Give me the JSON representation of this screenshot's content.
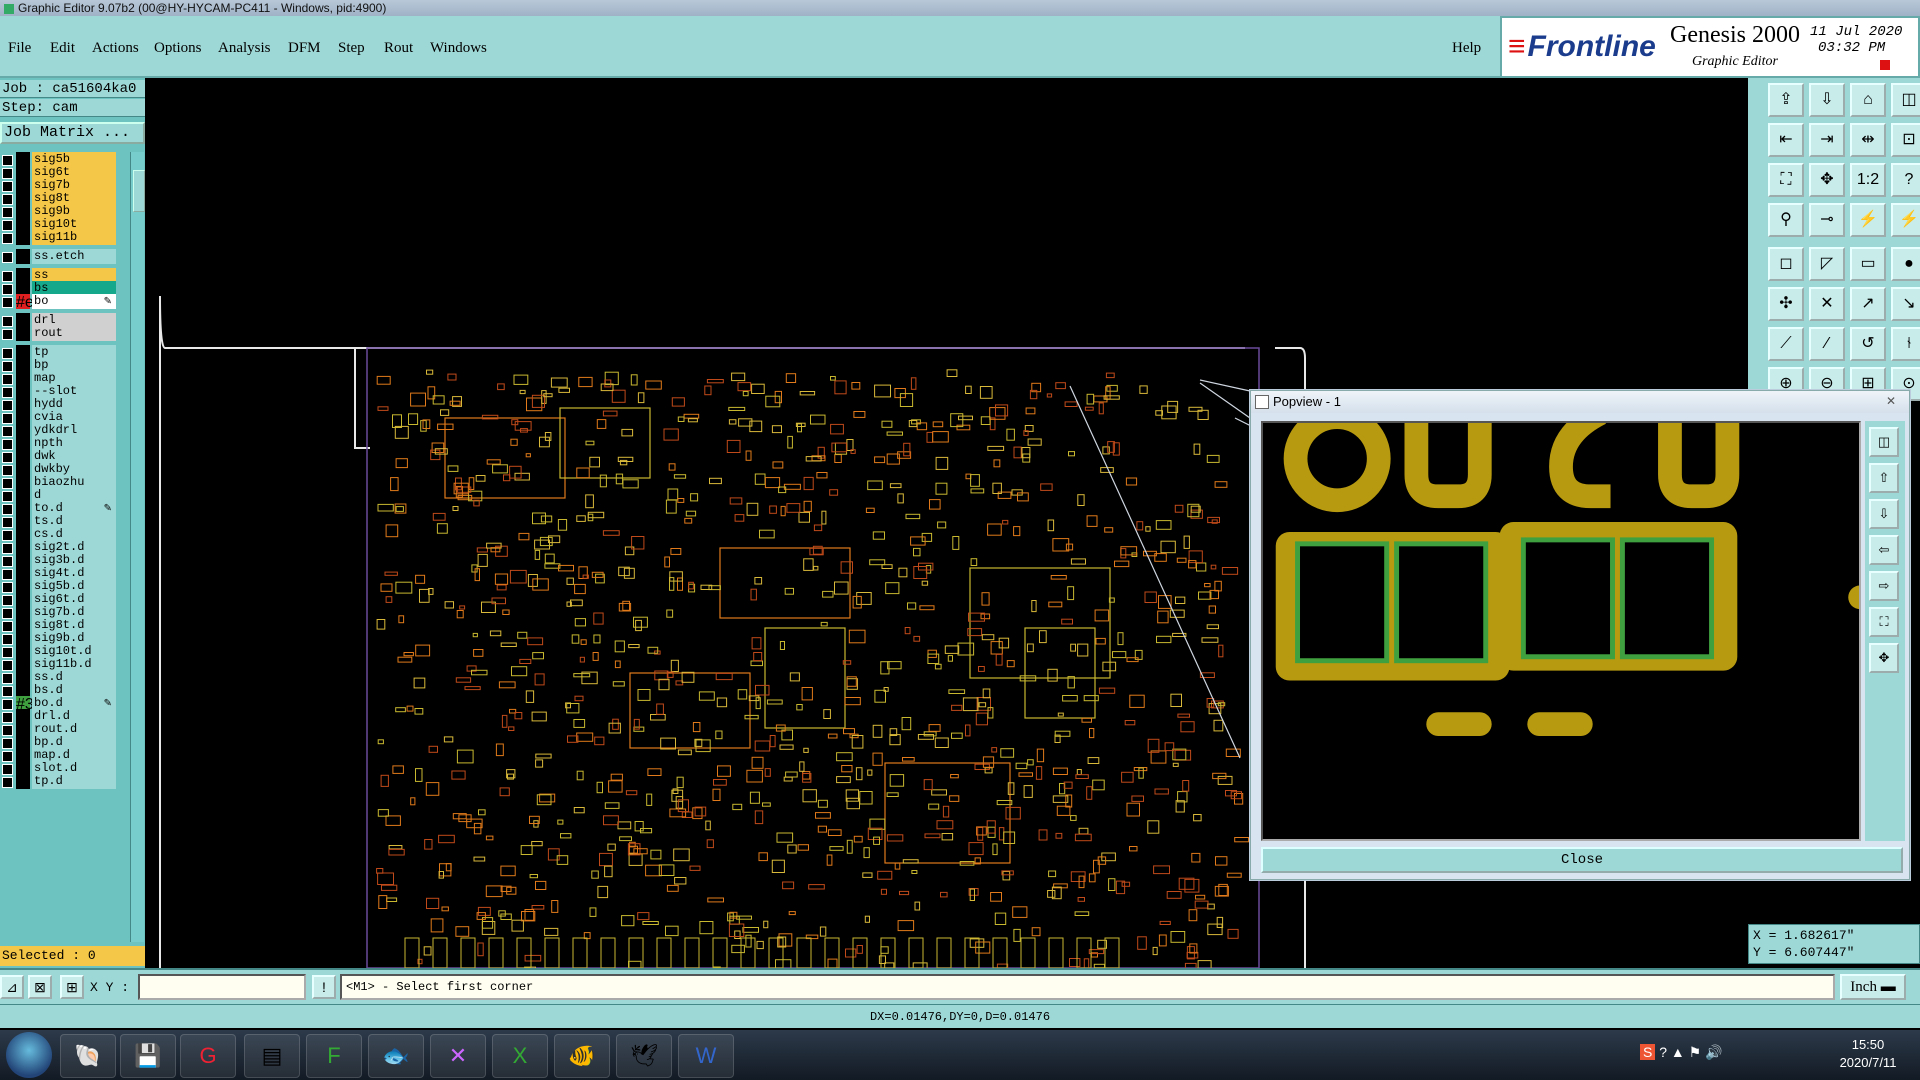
{
  "window": {
    "title": "Graphic Editor 9.07b2 (00@HY-HYCAM-PC411 - Windows, pid:4900)"
  },
  "menu": {
    "items": [
      "File",
      "Edit",
      "Actions",
      "Options",
      "Analysis",
      "DFM",
      "Step",
      "Rout",
      "Windows"
    ],
    "help": "Help"
  },
  "brand": {
    "logo": "Frontline",
    "product": "Genesis 2000",
    "subtitle": "Graphic Editor",
    "date": "11 Jul 2020",
    "time": "03:32 PM"
  },
  "panel": {
    "job": "Job : ca51604ka0",
    "step": "Step: cam",
    "job_matrix": "Job Matrix ...",
    "selected": "Selected : 0"
  },
  "layers": [
    {
      "name": "sig5b",
      "color": "#f5c748",
      "mark": ""
    },
    {
      "name": "sig6t",
      "color": "#f5c748",
      "mark": ""
    },
    {
      "name": "sig7b",
      "color": "#f5c748",
      "mark": ""
    },
    {
      "name": "sig8t",
      "color": "#f5c748",
      "mark": ""
    },
    {
      "name": "sig9b",
      "color": "#f5c748",
      "mark": ""
    },
    {
      "name": "sig10t",
      "color": "#f5c748",
      "mark": ""
    },
    {
      "name": "sig11b",
      "color": "#f5c748",
      "mark": ""
    },
    {
      "name": "ss.etch",
      "color": "#9ed8d6",
      "mark": ""
    },
    {
      "name": "ss",
      "color": "#f5c748",
      "mark": ""
    },
    {
      "name": "bs",
      "color": "#16a88a",
      "mark": ""
    },
    {
      "name": "bo",
      "color": "#ffffff",
      "mark": "✎",
      "swatch": "#e02020"
    },
    {
      "name": "drl",
      "color": "#d0d0d0",
      "mark": ""
    },
    {
      "name": "rout",
      "color": "#d0d0d0",
      "mark": ""
    },
    {
      "name": "tp",
      "color": "#9ed8d6",
      "mark": ""
    },
    {
      "name": "bp",
      "color": "#9ed8d6",
      "mark": ""
    },
    {
      "name": "map",
      "color": "#9ed8d6",
      "mark": ""
    },
    {
      "name": "--slot",
      "color": "#9ed8d6",
      "mark": ""
    },
    {
      "name": "hydd",
      "color": "#9ed8d6",
      "mark": ""
    },
    {
      "name": "cvia",
      "color": "#9ed8d6",
      "mark": ""
    },
    {
      "name": "ydkdrl",
      "color": "#9ed8d6",
      "mark": ""
    },
    {
      "name": "npth",
      "color": "#9ed8d6",
      "mark": ""
    },
    {
      "name": "dwk",
      "color": "#9ed8d6",
      "mark": ""
    },
    {
      "name": "dwkby",
      "color": "#9ed8d6",
      "mark": ""
    },
    {
      "name": "biaozhu",
      "color": "#9ed8d6",
      "mark": ""
    },
    {
      "name": "d",
      "color": "#9ed8d6",
      "mark": ""
    },
    {
      "name": "to.d",
      "color": "#9ed8d6",
      "mark": "✎"
    },
    {
      "name": "ts.d",
      "color": "#9ed8d6",
      "mark": ""
    },
    {
      "name": "cs.d",
      "color": "#9ed8d6",
      "mark": ""
    },
    {
      "name": "sig2t.d",
      "color": "#9ed8d6",
      "mark": ""
    },
    {
      "name": "sig3b.d",
      "color": "#9ed8d6",
      "mark": ""
    },
    {
      "name": "sig4t.d",
      "color": "#9ed8d6",
      "mark": ""
    },
    {
      "name": "sig5b.d",
      "color": "#9ed8d6",
      "mark": ""
    },
    {
      "name": "sig6t.d",
      "color": "#9ed8d6",
      "mark": ""
    },
    {
      "name": "sig7b.d",
      "color": "#9ed8d6",
      "mark": ""
    },
    {
      "name": "sig8t.d",
      "color": "#9ed8d6",
      "mark": ""
    },
    {
      "name": "sig9b.d",
      "color": "#9ed8d6",
      "mark": ""
    },
    {
      "name": "sig10t.d",
      "color": "#9ed8d6",
      "mark": ""
    },
    {
      "name": "sig11b.d",
      "color": "#9ed8d6",
      "mark": ""
    },
    {
      "name": "ss.d",
      "color": "#9ed8d6",
      "mark": ""
    },
    {
      "name": "bs.d",
      "color": "#9ed8d6",
      "mark": ""
    },
    {
      "name": "bo.d",
      "color": "#9ed8d6",
      "mark": "✎",
      "swatch": "#3fa03f"
    },
    {
      "name": "drl.d",
      "color": "#9ed8d6",
      "mark": ""
    },
    {
      "name": "rout.d",
      "color": "#9ed8d6",
      "mark": ""
    },
    {
      "name": "bp.d",
      "color": "#9ed8d6",
      "mark": ""
    },
    {
      "name": "map.d",
      "color": "#9ed8d6",
      "mark": ""
    },
    {
      "name": "slot.d",
      "color": "#9ed8d6",
      "mark": ""
    },
    {
      "name": "tp.d",
      "color": "#9ed8d6",
      "mark": ""
    }
  ],
  "coords": {
    "x": "X = 1.682617\"",
    "y": "Y = 6.607447\""
  },
  "popview": {
    "title": "Popview - 1",
    "close": "Close"
  },
  "command": {
    "xy_label": "X Y :",
    "xy_value": "",
    "prompt": "<M1> - Select first corner",
    "unit": "Inch"
  },
  "status": {
    "text": "DX=0.01476,DY=0,D=0.01476"
  },
  "taskbar": {
    "time": "15:50",
    "date": "2020/7/11"
  },
  "colors": {
    "pad": "#b89a10",
    "pad_green": "#3fa03f",
    "trace_orange": "#e07a1a",
    "trace_yellow": "#c8b830"
  }
}
